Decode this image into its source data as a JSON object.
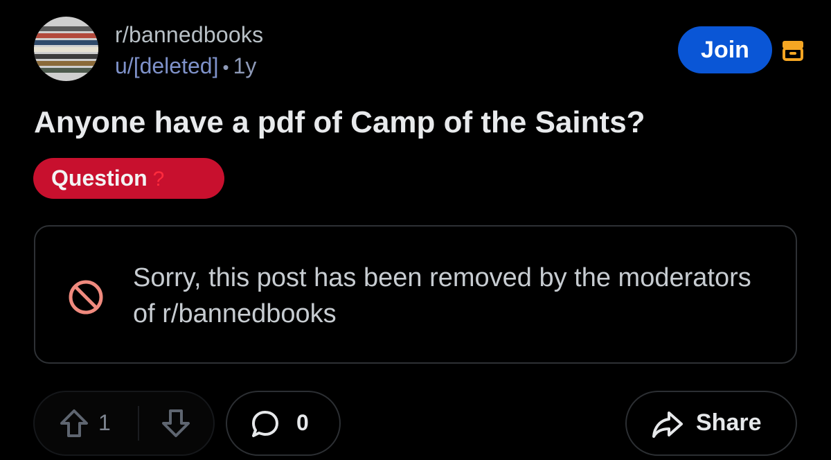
{
  "header": {
    "subreddit": "r/bannedbooks",
    "author": "u/[deleted]",
    "separator": "•",
    "age": "1y",
    "join_label": "Join",
    "archive_icon": "archive-icon"
  },
  "post": {
    "title": "Anyone have a pdf of Camp of the Saints?",
    "flair": {
      "label": "Question",
      "emoji": "?",
      "color": "#c8102e"
    },
    "removed_notice": "Sorry, this post has been removed by the moderators of r/bannedbooks"
  },
  "actions": {
    "vote_count": "1",
    "comment_count": "0",
    "share_label": "Share"
  },
  "colors": {
    "background": "#000000",
    "join_button": "#0a56d6",
    "archive_icon": "#f5a623",
    "removed_icon": "#f08a7e"
  }
}
